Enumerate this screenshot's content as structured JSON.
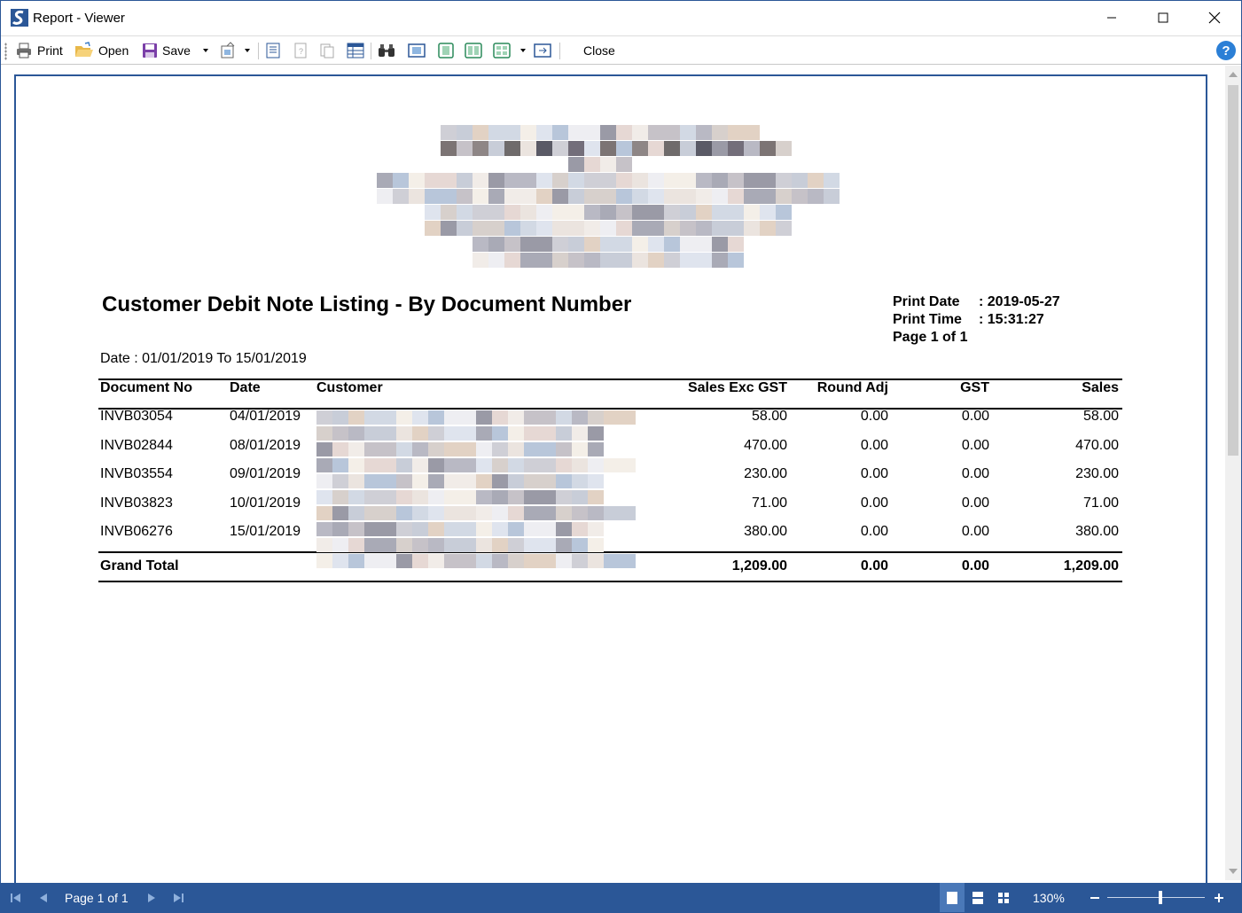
{
  "window": {
    "title": "Report - Viewer"
  },
  "toolbar": {
    "print_label": "Print",
    "open_label": "Open",
    "save_label": "Save",
    "close_label": "Close",
    "help_label": "?"
  },
  "report": {
    "title": "Customer Debit Note Listing - By Document Number",
    "print_date_label": "Print Date",
    "print_date_value": ": 2019-05-27",
    "print_time_label": "Print Time",
    "print_time_value": ": 15:31:27",
    "page_label": "Page 1 of 1",
    "date_range": "Date : 01/01/2019 To 15/01/2019",
    "columns": [
      "Document No",
      "Date",
      "Customer",
      "Sales Exc GST",
      "Round Adj",
      "GST",
      "Sales"
    ],
    "rows": [
      {
        "doc": "INVB03054",
        "date": "04/01/2019",
        "sales_exc": "58.00",
        "round": "0.00",
        "gst": "0.00",
        "sales": "58.00"
      },
      {
        "doc": "INVB02844",
        "date": "08/01/2019",
        "sales_exc": "470.00",
        "round": "0.00",
        "gst": "0.00",
        "sales": "470.00"
      },
      {
        "doc": "INVB03554",
        "date": "09/01/2019",
        "sales_exc": "230.00",
        "round": "0.00",
        "gst": "0.00",
        "sales": "230.00"
      },
      {
        "doc": "INVB03823",
        "date": "10/01/2019",
        "sales_exc": "71.00",
        "round": "0.00",
        "gst": "0.00",
        "sales": "71.00"
      },
      {
        "doc": "INVB06276",
        "date": "15/01/2019",
        "sales_exc": "380.00",
        "round": "0.00",
        "gst": "0.00",
        "sales": "380.00"
      }
    ],
    "total": {
      "label": "Grand Total",
      "sales_exc": "1,209.00",
      "round": "0.00",
      "gst": "0.00",
      "sales": "1,209.00"
    }
  },
  "statusbar": {
    "page_indicator": "Page 1 of 1",
    "zoom": "130%"
  },
  "colors": {
    "accent": "#2b5797",
    "help": "#2b7fd6"
  }
}
